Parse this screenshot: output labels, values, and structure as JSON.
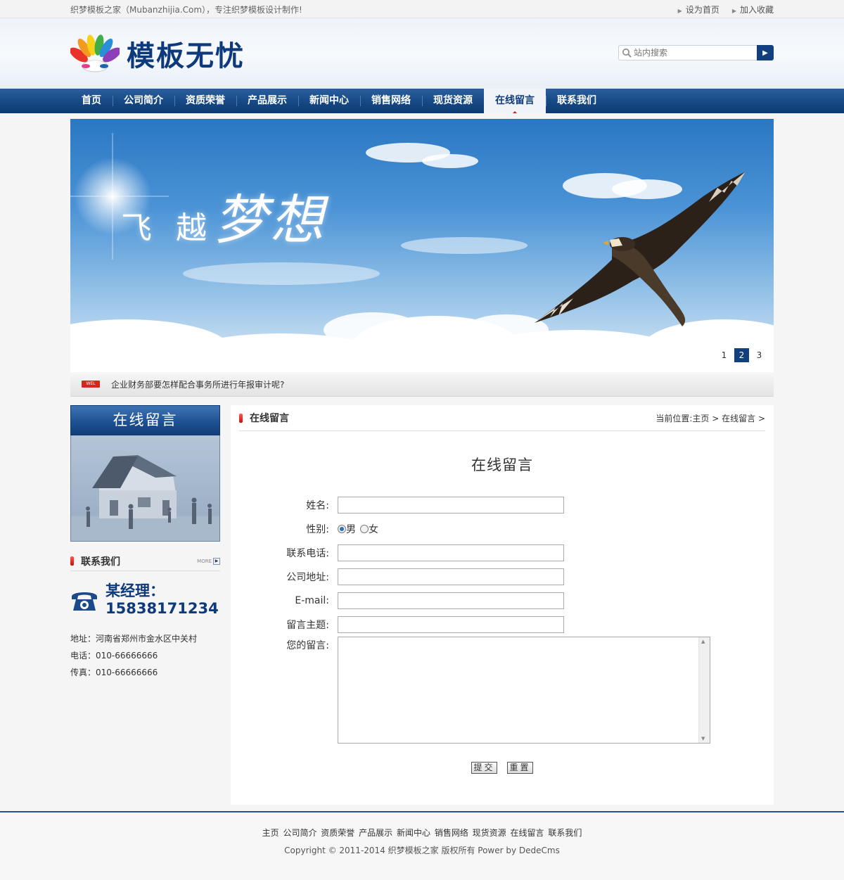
{
  "topbar": {
    "slogan": "织梦模板之家（Mubanzhijia.Com），专注织梦模板设计制作!",
    "set_home": "设为首页",
    "add_favorite": "加入收藏"
  },
  "header": {
    "logo_text": "模板无忧",
    "search_placeholder": "站内搜索"
  },
  "nav": {
    "items": [
      "首页",
      "公司简介",
      "资质荣誉",
      "产品展示",
      "新闻中心",
      "销售网络",
      "现货资源",
      "在线留言",
      "联系我们"
    ],
    "active": "在线留言"
  },
  "banner": {
    "title_small": "飞 越",
    "title_big": "梦想",
    "pages": [
      "1",
      "2",
      "3"
    ],
    "active_page": "2"
  },
  "notice": {
    "badge": "WEL",
    "text": "企业财务部要怎样配合事务所进行年报审计呢?"
  },
  "sidebar": {
    "head": "在线留言",
    "contact_title": "联系我们",
    "more": "MORE",
    "manager_name": "某经理：",
    "manager_phone": "15838171234",
    "address": "地址：河南省郑州市金水区中关村",
    "tel": "电话：010-66666666",
    "fax": "传真：010-66666666"
  },
  "content": {
    "section_title": "在线留言",
    "crumb_prefix": "当前位置:",
    "crumb_home": "主页",
    "crumb_sep1": " > ",
    "crumb_current": "在线留言",
    "crumb_sep2": " > ",
    "form_title": "在线留言",
    "labels": {
      "name": "姓名:",
      "gender": "性别:",
      "phone": "联系电话:",
      "address": "公司地址:",
      "email": "E-mail:",
      "subject": "留言主题:",
      "message": "您的留言:"
    },
    "gender_options": [
      "男",
      "女"
    ],
    "submit": "提交",
    "reset": "重置"
  },
  "footer": {
    "links": [
      "主页",
      "公司简介",
      "资质荣誉",
      "产品展示",
      "新闻中心",
      "销售网络",
      "现货资源",
      "在线留言",
      "联系我们"
    ],
    "copyright": "Copyright © 2011-2014 织梦模板之家 版权所有 Power by DedeCms"
  },
  "colors": {
    "brand_blue": "#12407f",
    "accent_red": "#d7261e"
  }
}
